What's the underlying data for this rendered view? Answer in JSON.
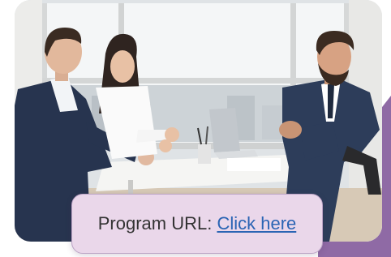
{
  "photo": {
    "description_icon": "meeting-photo"
  },
  "program_link": {
    "prefix": "Program URL:",
    "link_text": "Click here"
  },
  "colors": {
    "accent": "#8f6aa5",
    "card_background": "#ead7ea",
    "link": "#2a64b4",
    "text": "#333333"
  }
}
